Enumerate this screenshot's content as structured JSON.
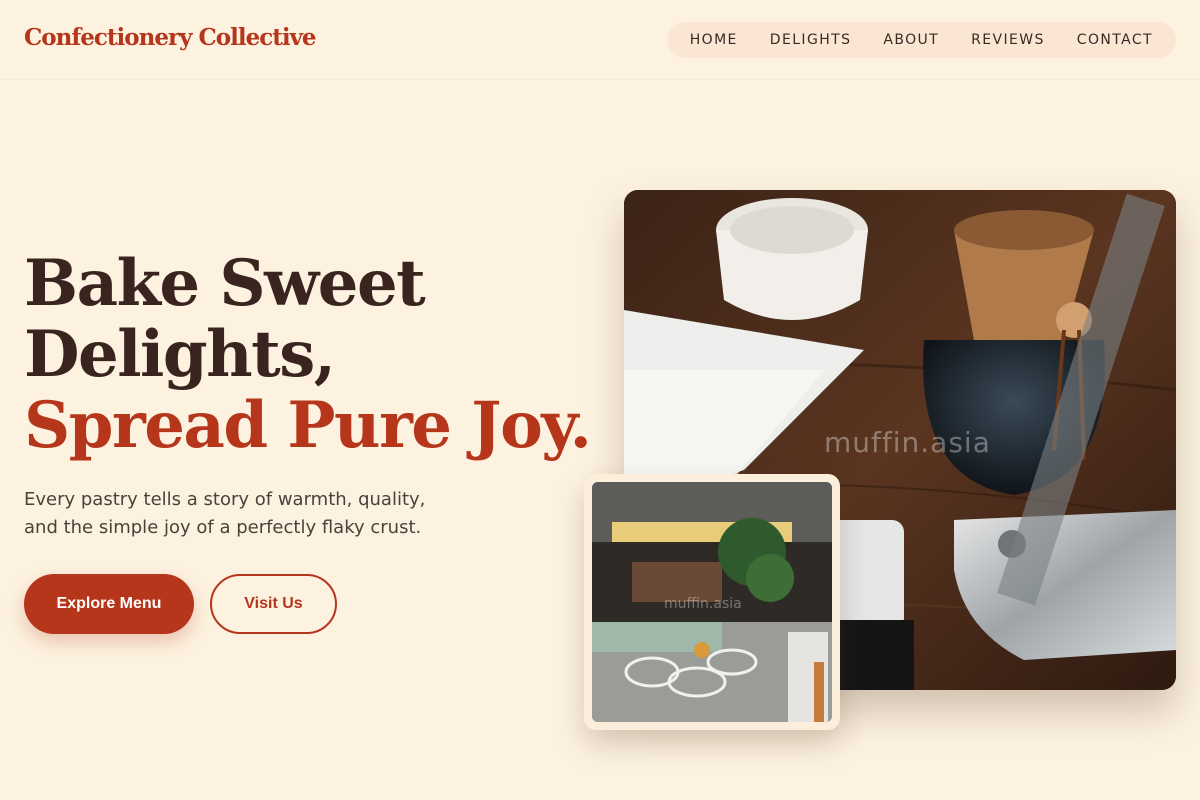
{
  "brand": {
    "name": "Confectionery Collective"
  },
  "nav": {
    "items": [
      {
        "label": "HOME"
      },
      {
        "label": "DELIGHTS"
      },
      {
        "label": "ABOUT"
      },
      {
        "label": "REVIEWS"
      },
      {
        "label": "CONTACT"
      }
    ]
  },
  "hero": {
    "headline_line1": "Bake Sweet",
    "headline_line2": "Delights,",
    "headline_accent": "Spread Pure Joy.",
    "subtext_line1": "Every pastry tells a story of warmth, quality,",
    "subtext_line2": "and the simple joy of a perfectly flaky crust.",
    "primary_button": "Explore Menu",
    "secondary_button": "Visit Us"
  },
  "images": {
    "main_watermark": "muffin.asia",
    "small_watermark": "muffin.asia"
  },
  "colors": {
    "background": "#fdf2e0",
    "accent": "#b5361a",
    "text_dark": "#3a2420",
    "nav_pill": "#fbe6d4"
  }
}
